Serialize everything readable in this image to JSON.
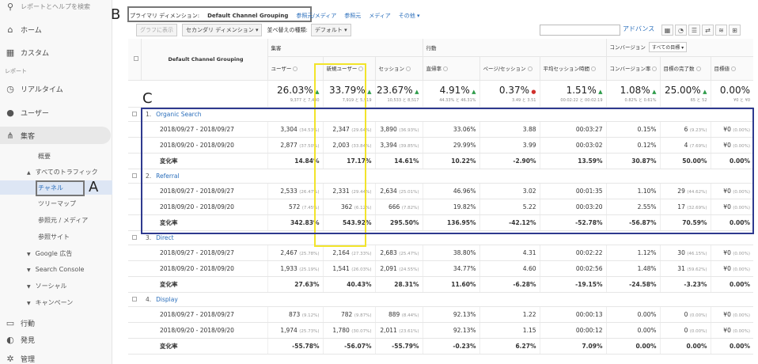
{
  "sidebar": {
    "search_label": "レポートとヘルプを検索",
    "items": [
      {
        "icon": "home-icon",
        "glyph": "⌂",
        "label": "ホーム"
      },
      {
        "icon": "customize-icon",
        "glyph": "▦",
        "label": "カスタム"
      }
    ],
    "reports_heading": "レポート",
    "report_items": [
      {
        "icon": "clock-icon",
        "glyph": "◷",
        "label": "リアルタイム"
      },
      {
        "icon": "user-icon",
        "glyph": "●",
        "label": "ユーザー"
      },
      {
        "icon": "acquisition-icon",
        "glyph": "⋔",
        "label": "集客"
      }
    ],
    "sub_overview": "概要",
    "sub_all_traffic": "すべてのトラフィック",
    "sub_channels": "チャネル",
    "sub_treemap": "ツリーマップ",
    "sub_source_medium": "参照元 / メディア",
    "sub_referrals": "参照サイト",
    "sub_google_ads": "Google 広告",
    "sub_search_console": "Search Console",
    "sub_social": "ソーシャル",
    "sub_campaigns": "キャンペーン",
    "behavior": {
      "icon": "behavior-icon",
      "glyph": "▭",
      "label": "行動"
    },
    "conversion": {
      "icon": "lightbulb-icon",
      "glyph": "◐",
      "label": "発見"
    },
    "admin": {
      "icon": "gear-icon",
      "glyph": "✲",
      "label": "管理"
    }
  },
  "annotations": {
    "a": "A",
    "b": "B",
    "c": "C"
  },
  "primary_dimension": {
    "label": "プライマリ ディメンション:",
    "current": "Default Channel Grouping",
    "options": [
      "参照元/メディア",
      "参照元",
      "メディア",
      "その他 ▾"
    ]
  },
  "toolbar": {
    "plot": "グラフに表示",
    "secondary": "セカンダリ ディメンション ▾",
    "sort_label": "並べ替えの種類:",
    "sort_value": "デフォルト ▾",
    "advanced": "アドバンス"
  },
  "table": {
    "dim_header": "Default Channel Grouping",
    "group_acq": "集客",
    "group_beh": "行動",
    "group_conv": "コンバージョン",
    "goal_select": "すべての目標 ▾",
    "columns": [
      "ユーザー",
      "新規ユーザー",
      "セッション",
      "直帰率",
      "ページ/セッション",
      "平均セッション時間",
      "コンバージョン率",
      "目標の完了数",
      "目標値"
    ],
    "summary": [
      {
        "value": "26.03%",
        "dir": "▲",
        "sub": "9,377 と 7,440"
      },
      {
        "value": "33.79%",
        "dir": "▲",
        "sub": "7,919 と 5,919"
      },
      {
        "value": "23.67%",
        "dir": "▲",
        "sub": "10,533 と 8,517"
      },
      {
        "value": "4.91%",
        "dir": "▲",
        "sub": "44.33% と 46.31%"
      },
      {
        "value": "0.37%",
        "dir": "●",
        "sub": "3.49 と 3.51"
      },
      {
        "value": "1.51%",
        "dir": "▲",
        "sub": "00:02:22 と 00:02:19"
      },
      {
        "value": "1.08%",
        "dir": "▲",
        "sub": "0.82% と 0.61%"
      },
      {
        "value": "25.00%",
        "dir": "▲",
        "sub": "65 と 52"
      },
      {
        "value": "0.00%",
        "dir": "",
        "sub": "¥0 と ¥0"
      }
    ],
    "groups": [
      {
        "num": "1.",
        "name": "Organic Search",
        "rows": [
          {
            "period": "2018/09/27 - 2018/09/27",
            "cells": [
              [
                "3,304",
                "(34.53%)"
              ],
              [
                "2,347",
                "(29.64%)"
              ],
              [
                "3,890",
                "(36.93%)"
              ],
              [
                "33.06%",
                ""
              ],
              [
                "3.88",
                ""
              ],
              [
                "00:03:27",
                ""
              ],
              [
                "0.15%",
                ""
              ],
              [
                "6",
                "(9.23%)"
              ],
              [
                "¥0",
                "(0.00%)"
              ]
            ]
          },
          {
            "period": "2018/09/20 - 2018/09/20",
            "cells": [
              [
                "2,877",
                "(37.50%)"
              ],
              [
                "2,003",
                "(33.84%)"
              ],
              [
                "3,394",
                "(39.85%)"
              ],
              [
                "29.99%",
                ""
              ],
              [
                "3.99",
                ""
              ],
              [
                "00:03:02",
                ""
              ],
              [
                "0.12%",
                ""
              ],
              [
                "4",
                "(7.69%)"
              ],
              [
                "¥0",
                "(0.00%)"
              ]
            ]
          }
        ],
        "change": {
          "label": "変化率",
          "cells": [
            "14.84%",
            "17.17%",
            "14.61%",
            "10.22%",
            "-2.90%",
            "13.59%",
            "30.87%",
            "50.00%",
            "0.00%"
          ]
        }
      },
      {
        "num": "2.",
        "name": "Referral",
        "rows": [
          {
            "period": "2018/09/27 - 2018/09/27",
            "cells": [
              [
                "2,533",
                "(26.47%)"
              ],
              [
                "2,331",
                "(29.44%)"
              ],
              [
                "2,634",
                "(25.01%)"
              ],
              [
                "46.96%",
                ""
              ],
              [
                "3.02",
                ""
              ],
              [
                "00:01:35",
                ""
              ],
              [
                "1.10%",
                ""
              ],
              [
                "29",
                "(44.62%)"
              ],
              [
                "¥0",
                "(0.00%)"
              ]
            ]
          },
          {
            "period": "2018/09/20 - 2018/09/20",
            "cells": [
              [
                "572",
                "(7.45%)"
              ],
              [
                "362",
                "(6.12%)"
              ],
              [
                "666",
                "(7.82%)"
              ],
              [
                "19.82%",
                ""
              ],
              [
                "5.22",
                ""
              ],
              [
                "00:03:20",
                ""
              ],
              [
                "2.55%",
                ""
              ],
              [
                "17",
                "(32.69%)"
              ],
              [
                "¥0",
                "(0.00%)"
              ]
            ]
          }
        ],
        "change": {
          "label": "変化率",
          "cells": [
            "342.83%",
            "543.92%",
            "295.50%",
            "136.95%",
            "-42.12%",
            "-52.78%",
            "-56.87%",
            "70.59%",
            "0.00%"
          ]
        }
      },
      {
        "num": "3.",
        "name": "Direct",
        "rows": [
          {
            "period": "2018/09/27 - 2018/09/27",
            "cells": [
              [
                "2,467",
                "(25.78%)"
              ],
              [
                "2,164",
                "(27.33%)"
              ],
              [
                "2,683",
                "(25.47%)"
              ],
              [
                "38.80%",
                ""
              ],
              [
                "4.31",
                ""
              ],
              [
                "00:02:22",
                ""
              ],
              [
                "1.12%",
                ""
              ],
              [
                "30",
                "(46.15%)"
              ],
              [
                "¥0",
                "(0.00%)"
              ]
            ]
          },
          {
            "period": "2018/09/20 - 2018/09/20",
            "cells": [
              [
                "1,933",
                "(25.19%)"
              ],
              [
                "1,541",
                "(26.03%)"
              ],
              [
                "2,091",
                "(24.55%)"
              ],
              [
                "34.77%",
                ""
              ],
              [
                "4.60",
                ""
              ],
              [
                "00:02:56",
                ""
              ],
              [
                "1.48%",
                ""
              ],
              [
                "31",
                "(59.62%)"
              ],
              [
                "¥0",
                "(0.00%)"
              ]
            ]
          }
        ],
        "change": {
          "label": "変化率",
          "cells": [
            "27.63%",
            "40.43%",
            "28.31%",
            "11.60%",
            "-6.28%",
            "-19.15%",
            "-24.58%",
            "-3.23%",
            "0.00%"
          ]
        }
      },
      {
        "num": "4.",
        "name": "Display",
        "rows": [
          {
            "period": "2018/09/27 - 2018/09/27",
            "cells": [
              [
                "873",
                "(9.12%)"
              ],
              [
                "782",
                "(9.87%)"
              ],
              [
                "889",
                "(8.44%)"
              ],
              [
                "92.13%",
                ""
              ],
              [
                "1.22",
                ""
              ],
              [
                "00:00:13",
                ""
              ],
              [
                "0.00%",
                ""
              ],
              [
                "0",
                "(0.00%)"
              ],
              [
                "¥0",
                "(0.00%)"
              ]
            ]
          },
          {
            "period": "2018/09/20 - 2018/09/20",
            "cells": [
              [
                "1,974",
                "(25.73%)"
              ],
              [
                "1,780",
                "(30.07%)"
              ],
              [
                "2,011",
                "(23.61%)"
              ],
              [
                "92.13%",
                ""
              ],
              [
                "1.15",
                ""
              ],
              [
                "00:00:12",
                ""
              ],
              [
                "0.00%",
                ""
              ],
              [
                "0",
                "(0.00%)"
              ],
              [
                "¥0",
                "(0.00%)"
              ]
            ]
          }
        ],
        "change": {
          "label": "変化率",
          "cells": [
            "-55.78%",
            "-56.07%",
            "-55.79%",
            "-0.23%",
            "6.27%",
            "7.09%",
            "0.00%",
            "0.00%",
            "0.00%"
          ]
        }
      }
    ]
  },
  "colors": {
    "link": "#2a6ebb",
    "up": "#2e9c4a",
    "down": "#d0312d",
    "yellow": "#f2e42a",
    "blue": "#2f3a8f"
  }
}
